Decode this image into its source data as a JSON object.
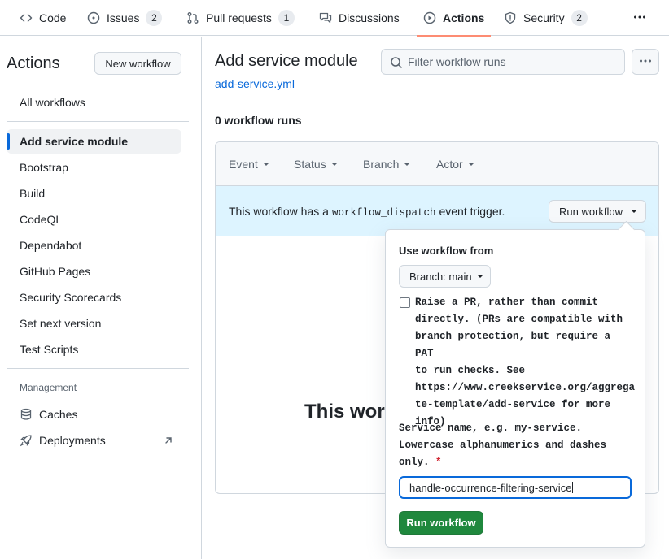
{
  "nav": {
    "tabs": [
      {
        "label": "Code",
        "icon": "code-icon"
      },
      {
        "label": "Issues",
        "icon": "issue-icon",
        "count": "2"
      },
      {
        "label": "Pull requests",
        "icon": "pull-request-icon",
        "count": "1"
      },
      {
        "label": "Discussions",
        "icon": "discussion-icon"
      },
      {
        "label": "Actions",
        "icon": "play-icon",
        "active": true
      },
      {
        "label": "Security",
        "icon": "shield-icon",
        "count": "2"
      }
    ]
  },
  "sidebar": {
    "title": "Actions",
    "new_workflow_label": "New workflow",
    "items": [
      {
        "label": "All workflows"
      },
      {
        "label": "Add service module",
        "selected": true
      },
      {
        "label": "Bootstrap"
      },
      {
        "label": "Build"
      },
      {
        "label": "CodeQL"
      },
      {
        "label": "Dependabot"
      },
      {
        "label": "GitHub Pages"
      },
      {
        "label": "Security Scorecards"
      },
      {
        "label": "Set next version"
      },
      {
        "label": "Test Scripts"
      }
    ],
    "management_heading": "Management",
    "management_items": [
      {
        "label": "Caches",
        "icon": "database-icon"
      },
      {
        "label": "Deployments",
        "icon": "rocket-icon"
      }
    ]
  },
  "main": {
    "title": "Add service module",
    "workflow_file": "add-service.yml",
    "filter_placeholder": "Filter workflow runs",
    "runs_count": "0 workflow runs",
    "filters": [
      "Event",
      "Status",
      "Branch",
      "Actor"
    ],
    "dispatch": {
      "prefix": "This workflow has a",
      "code": "workflow_dispatch",
      "suffix": "event trigger.",
      "run_button": "Run workflow"
    },
    "empty_title": "This workfl"
  },
  "popover": {
    "use_from_label": "Use workflow from",
    "branch_label": "Branch: main",
    "checkbox_lines": [
      "Raise a PR, rather than commit",
      "directly. (PRs are compatible with",
      "branch protection, but require a PAT",
      "to run checks. See",
      "https://www.creekservice.org/aggrega",
      "te-template/add-service for more",
      "info)"
    ],
    "checkbox_checked": false,
    "service_label_lines": [
      "Service name, e.g. my-service.",
      "Lowercase alphanumerics and dashes",
      "only."
    ],
    "required_mark": "*",
    "service_value": "handle-occurrence-filtering-service",
    "submit_label": "Run workflow"
  },
  "colors": {
    "accent": "#0969da",
    "active_tab_underline": "#fd8c73",
    "run_button_green": "#1f883d",
    "dispatch_bg": "#ddf4ff"
  }
}
